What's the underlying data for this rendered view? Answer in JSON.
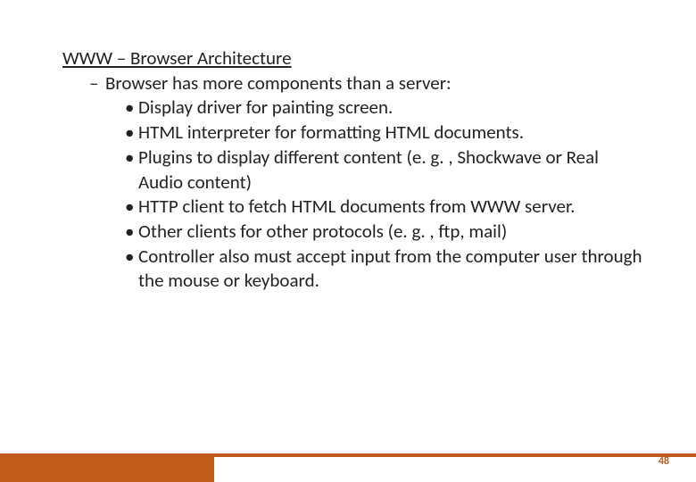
{
  "title": "WWW – Browser Architecture",
  "subtitle": "Browser has more components than a server:",
  "bullets": [
    "Display driver for painting screen.",
    "HTML interpreter for formatting HTML documents.",
    "Plugins to display different content (e. g. , Shockwave or Real Audio content)",
    "HTTP client to fetch HTML documents from WWW server.",
    "Other clients for other protocols (e. g. , ftp, mail)",
    "Controller also must accept input from the computer user through the mouse or keyboard."
  ],
  "page_number": "48"
}
